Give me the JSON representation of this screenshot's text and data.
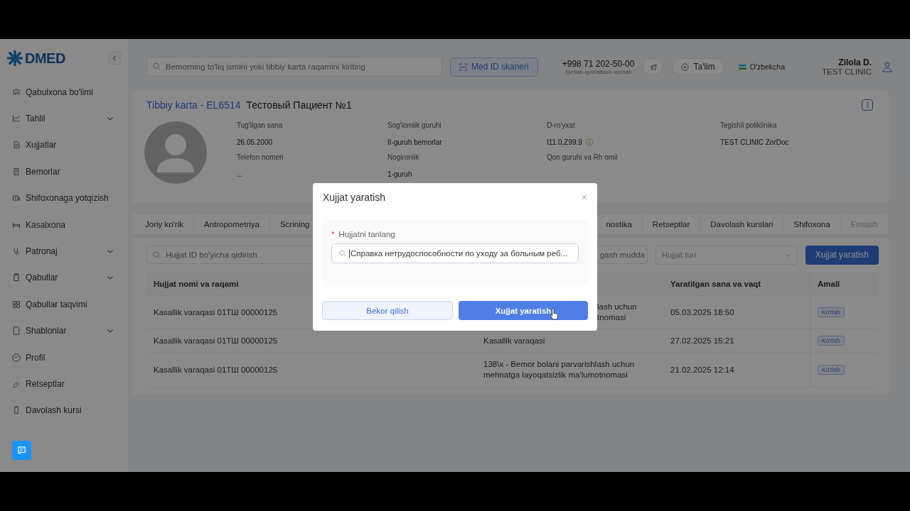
{
  "sidebar": {
    "logo": "DMED",
    "items": [
      {
        "label": "Qabulxona bo'limi",
        "has_submenu": false
      },
      {
        "label": "Tahlil",
        "has_submenu": true
      },
      {
        "label": "Xujjatlar",
        "has_submenu": false
      },
      {
        "label": "Bemorlar",
        "has_submenu": false
      },
      {
        "label": "Shifoxonaga yotqizish",
        "has_submenu": false
      },
      {
        "label": "Kasalxona",
        "has_submenu": false
      },
      {
        "label": "Patronaj",
        "has_submenu": true
      },
      {
        "label": "Qabullar",
        "has_submenu": true
      },
      {
        "label": "Qabullar taqvimi",
        "has_submenu": false
      },
      {
        "label": "Shablonlar",
        "has_submenu": true
      },
      {
        "label": "Profil",
        "has_submenu": false
      },
      {
        "label": "Retseptlar",
        "has_submenu": false
      },
      {
        "label": "Davolash kursi",
        "has_submenu": false
      }
    ]
  },
  "header": {
    "search": {
      "placeholder": "Bemorning to'liq ismini yoki tibbiy karta raqamini kiriting"
    },
    "scanner_button": "Med ID skaneri",
    "phone": "+998 71 202-50-00",
    "support": "Qo'llab-quvvatlash xizmati",
    "learn_button": "Ta'lim",
    "language": "O'zbekcha",
    "user": {
      "name": "Zilola D.",
      "clinic": "TEST CLINIC"
    }
  },
  "patient": {
    "card_title": "Tibbiy karta - EL6514",
    "name": "Тестовый Пациент №1",
    "fields": [
      {
        "label": "Tug'ilgan sana",
        "value": "26.05.2000",
        "info": false
      },
      {
        "label": "Sog'lomlik guruhi",
        "value": "II-guruh bemorlar",
        "info": false
      },
      {
        "label": "D-ro'yxat",
        "value": "I11.0,Z99.9",
        "info": true
      },
      {
        "label": "Tegishli poliklinika",
        "value": "TEST CLINIC ZorDoc",
        "info": false
      },
      {
        "label": "Telefon nomeri",
        "value": "...",
        "info": false
      },
      {
        "label": "Nogironlik",
        "value": "1-guruh",
        "info": false
      },
      {
        "label": "Qon guruhi va Rh omil",
        "info": false
      }
    ]
  },
  "tabs": [
    {
      "label": "Joriy ko'rik",
      "selected": false,
      "disabled": false
    },
    {
      "label": "Antropometriya",
      "selected": false,
      "disabled": false
    },
    {
      "label": "Scrining",
      "selected": false,
      "disabled": false
    },
    {
      "label": "nostika",
      "selected": false,
      "disabled": false
    },
    {
      "label": "Retseptlar",
      "selected": false,
      "disabled": false
    },
    {
      "label": "Davolash kurslari",
      "selected": false,
      "disabled": false
    },
    {
      "label": "Shifoxona",
      "selected": false,
      "disabled": false
    },
    {
      "label": "Emlash",
      "selected": false,
      "disabled": true
    }
  ],
  "filters": {
    "search": {
      "placeholder": "Hujjat ID bo'yicha qidirish"
    },
    "date": {
      "placeholder": "gash mudda"
    },
    "type": {
      "placeholder": "Hujjat turi"
    },
    "create_button": "Xujjat yaratish"
  },
  "table": {
    "columns": [
      "Hujjat nomi va raqami",
      "Yaratilgan sana va vaqt",
      "Amall"
    ],
    "rows": [
      {
        "name": "Kasallik varaqasi 01ТШ 00000125",
        "type": [
          "lash uchun",
          "tnomasi"
        ],
        "cut": true,
        "created": "05.03.2025 18:50",
        "action": "Ko'rish"
      },
      {
        "name": "Kasallik varaqasi 01ТШ 00000125",
        "type": [
          "Kasallik varaqasi"
        ],
        "cut": false,
        "created": "27.02.2025 15:21",
        "action": "Ko'rish"
      },
      {
        "name": "Kasallik varaqasi 01ТШ 00000125",
        "type": [
          "138\\x - Bemor bolani parvarishlash uchun",
          "mehnatga layoqatsizlik ma'lumotnomasi"
        ],
        "cut": false,
        "created": "21.02.2025 12:14",
        "action": "Ko'rish"
      }
    ]
  },
  "modal": {
    "title": "Xujjat yaratish",
    "close": "×",
    "field": {
      "label": "Hujjatni tanlang",
      "required_mark": "*",
      "value": "Справка нетрудоспособности по уходу за больным реб..."
    },
    "cancel_button": "Bekor qilish",
    "confirm_button": "Xujjat yaratish"
  }
}
